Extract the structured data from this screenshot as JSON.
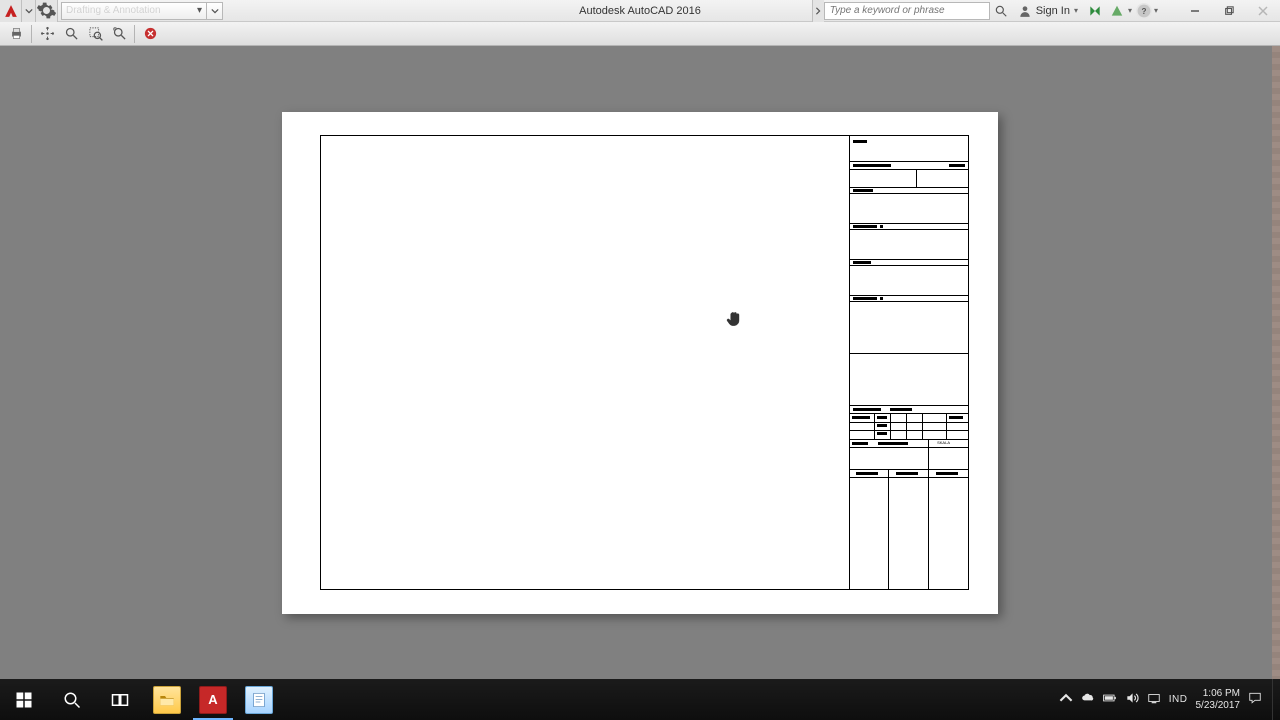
{
  "titlebar": {
    "app_title": "Autodesk AutoCAD 2016",
    "workspace_label": "Drafting & Annotation",
    "search_placeholder": "Type a keyword or phrase",
    "sign_in_label": "Sign In"
  },
  "taskbar": {
    "lang": "IND",
    "time": "1:06 PM",
    "date": "5/23/2017"
  },
  "titleblock": {
    "skala_label": "SKALA"
  }
}
